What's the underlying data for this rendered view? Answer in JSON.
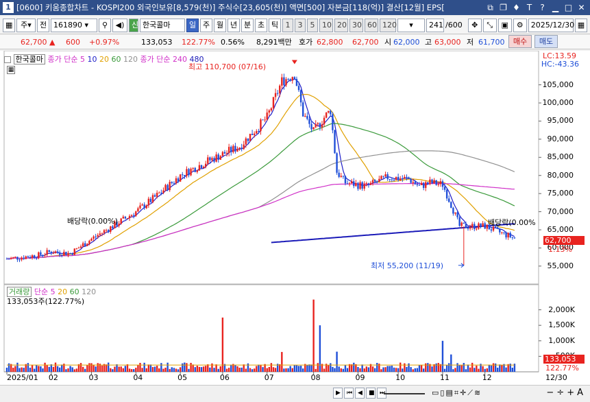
{
  "window": {
    "title": "[0600] 키움종합차트 - KOSPI200 외국인보유[8,579(천)] 주식수[23,605(천)] 액면[500] 자본금[118(억)] 결산[12월] EPS[",
    "number": "1"
  },
  "toolbar": {
    "market": "주",
    "type": "전",
    "code": "161890",
    "name_badge": "신",
    "name": "한국콜마",
    "periods": [
      "일",
      "주",
      "월",
      "년",
      "분",
      "초",
      "틱"
    ],
    "intervals": [
      "1",
      "3",
      "5",
      "10",
      "20",
      "30",
      "60",
      "120"
    ],
    "count": "241",
    "count_total": "/600",
    "date": "2025/12/30"
  },
  "quote": {
    "price": "62,700",
    "change": "600",
    "change_pct": "+0.97%",
    "volume": "133,053",
    "vol_ratio": "122.77%",
    "turnover_pct": "0.56%",
    "amount": "8,291백만",
    "ask_label": "호가",
    "ask1": "62,800",
    "ask2": "62,700",
    "open_label": "시",
    "open": "62,000",
    "high_label": "고",
    "high": "63,000",
    "low_label": "저",
    "low": "61,700",
    "buy": "매수",
    "sell": "매도"
  },
  "legend": {
    "name": "한국콜마",
    "ma_label": "종가 단순",
    "ma5": "5",
    "ma10": "10",
    "ma20": "20",
    "ma60": "60",
    "ma120": "120",
    "ma2_label": "종가 단순",
    "ma240": "240",
    "ma480": "480"
  },
  "corner": {
    "lc": "LC:13.59",
    "hc": "HC:-43.36"
  },
  "annotations": {
    "high": "최고 110,700 (07/16)",
    "low": "최저 55,200 (11/19)",
    "div1": "배당락(0.00%)",
    "div2": "배당락(0.00%",
    "price_tag": "62,700",
    "price_pct": "1.13%"
  },
  "price_axis": [
    "105,000",
    "100,000",
    "95,000",
    "90,000",
    "85,000",
    "80,000",
    "75,000",
    "70,000",
    "65,000",
    "60,000",
    "55,000"
  ],
  "volume_legend": {
    "label": "거래량",
    "ma_label": "단순",
    "ma5": "5",
    "ma20": "20",
    "ma60": "60",
    "ma120": "120",
    "current": "133,053주(122.77%)"
  },
  "volume_axis": [
    "2,000K",
    "1,500K",
    "1,000K",
    "500K"
  ],
  "volume_tag": "133,053",
  "volume_pct": "122.77%",
  "x_axis": [
    "2025/01",
    "02",
    "03",
    "04",
    "05",
    "06",
    "07",
    "08",
    "09",
    "10",
    "11",
    "12"
  ],
  "x_axis_end": "12/30",
  "colors": {
    "up": "#e8231f",
    "down": "#1f4fd8",
    "ma5": "#1c1cc8",
    "ma20": "#e0a000",
    "ma60": "#3a9a3a",
    "ma120": "#909090",
    "ma240": "#d02fc8",
    "ma480": "#1a1ab8"
  }
}
